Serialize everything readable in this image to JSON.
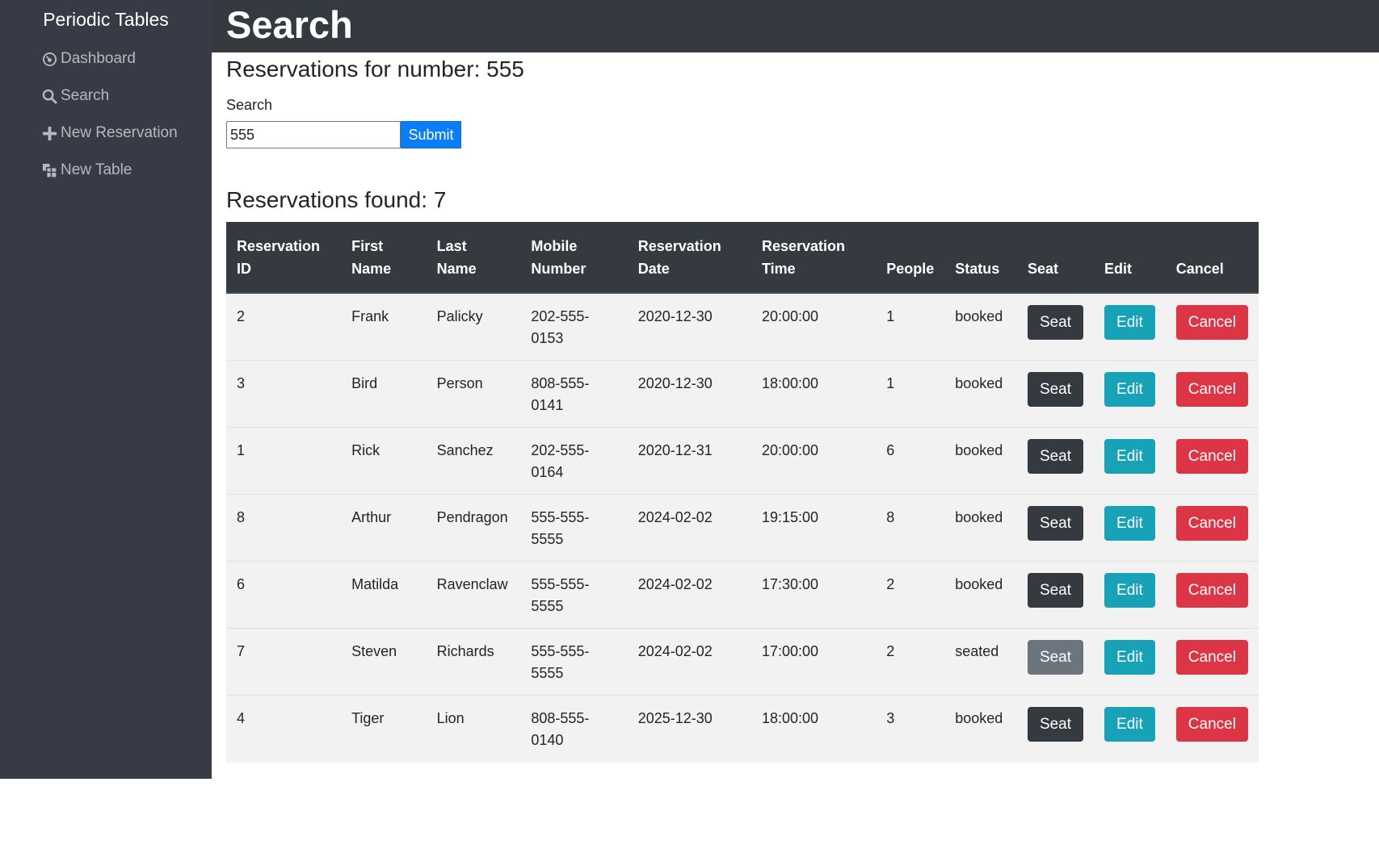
{
  "sidebar": {
    "brand": "Periodic Tables",
    "items": [
      {
        "label": "Dashboard",
        "icon": "dashboard-icon"
      },
      {
        "label": "Search",
        "icon": "search-icon"
      },
      {
        "label": "New Reservation",
        "icon": "plus-icon"
      },
      {
        "label": "New Table",
        "icon": "table-icon"
      }
    ]
  },
  "header": {
    "title": "Search"
  },
  "main": {
    "subtitle": "Reservations for number: 555",
    "search_label": "Search",
    "search_value": "555",
    "submit_label": "Submit",
    "found_title": "Reservations found: 7"
  },
  "table": {
    "headers": [
      {
        "l1": "Reservation",
        "l2": "ID"
      },
      {
        "l1": "First",
        "l2": "Name"
      },
      {
        "l1": "Last",
        "l2": "Name"
      },
      {
        "l1": "Mobile",
        "l2": "Number"
      },
      {
        "l1": "Reservation",
        "l2": "Date"
      },
      {
        "l1": "Reservation",
        "l2": "Time"
      },
      {
        "l1": "",
        "l2": "People"
      },
      {
        "l1": "",
        "l2": "Status"
      },
      {
        "l1": "",
        "l2": "Seat"
      },
      {
        "l1": "",
        "l2": "Edit"
      },
      {
        "l1": "",
        "l2": "Cancel"
      }
    ],
    "rows": [
      {
        "id": "2",
        "first": "Frank",
        "last": "Palicky",
        "mobile1": "202-555-",
        "mobile2": "0153",
        "date": "2020-12-30",
        "time": "20:00:00",
        "people": "1",
        "status": "booked",
        "seat": "Seat",
        "edit": "Edit",
        "cancel": "Cancel"
      },
      {
        "id": "3",
        "first": "Bird",
        "last": "Person",
        "mobile1": "808-555-",
        "mobile2": "0141",
        "date": "2020-12-30",
        "time": "18:00:00",
        "people": "1",
        "status": "booked",
        "seat": "Seat",
        "edit": "Edit",
        "cancel": "Cancel"
      },
      {
        "id": "1",
        "first": "Rick",
        "last": "Sanchez",
        "mobile1": "202-555-",
        "mobile2": "0164",
        "date": "2020-12-31",
        "time": "20:00:00",
        "people": "6",
        "status": "booked",
        "seat": "Seat",
        "edit": "Edit",
        "cancel": "Cancel"
      },
      {
        "id": "8",
        "first": "Arthur",
        "last": "Pendragon",
        "mobile1": "555-555-",
        "mobile2": "5555",
        "date": "2024-02-02",
        "time": "19:15:00",
        "people": "8",
        "status": "booked",
        "seat": "Seat",
        "edit": "Edit",
        "cancel": "Cancel"
      },
      {
        "id": "6",
        "first": "Matilda",
        "last": "Ravenclaw",
        "mobile1": "555-555-",
        "mobile2": "5555",
        "date": "2024-02-02",
        "time": "17:30:00",
        "people": "2",
        "status": "booked",
        "seat": "Seat",
        "edit": "Edit",
        "cancel": "Cancel"
      },
      {
        "id": "7",
        "first": "Steven",
        "last": "Richards",
        "mobile1": "555-555-",
        "mobile2": "5555",
        "date": "2024-02-02",
        "time": "17:00:00",
        "people": "2",
        "status": "seated",
        "seat": "Seat",
        "edit": "Edit",
        "cancel": "Cancel"
      },
      {
        "id": "4",
        "first": "Tiger",
        "last": "Lion",
        "mobile1": "808-555-",
        "mobile2": "0140",
        "date": "2025-12-30",
        "time": "18:00:00",
        "people": "3",
        "status": "booked",
        "seat": "Seat",
        "edit": "Edit",
        "cancel": "Cancel"
      }
    ]
  },
  "colors": {
    "sidebar_bg": "#383a45",
    "header_bg": "#343a40",
    "primary": "#0b7df5",
    "info": "#17a2b8",
    "danger": "#dc3545",
    "dark": "#343a40",
    "secondary": "#6c757d"
  }
}
